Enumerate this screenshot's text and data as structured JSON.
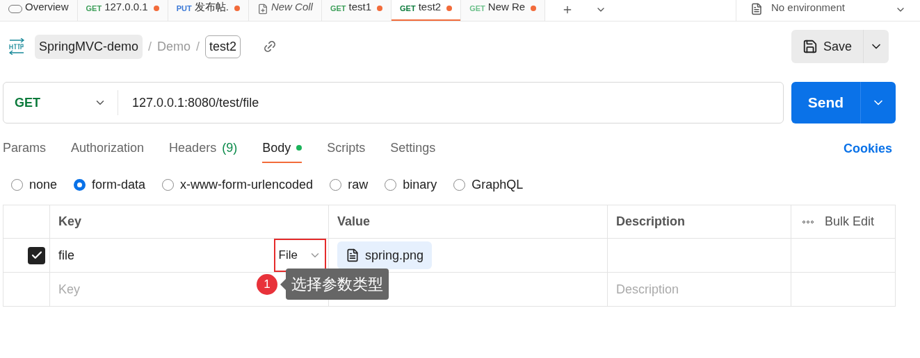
{
  "top_tabs": [
    {
      "kind": "overview",
      "label": "Overview",
      "selected": false
    },
    {
      "kind": "request",
      "method": "GET",
      "color": "#3e9f5a",
      "label": "127.0.0.1",
      "unsaved": true,
      "selected": false
    },
    {
      "kind": "request",
      "method": "PUT",
      "color": "#3a78d6",
      "label": "发布帖.",
      "unsaved": true,
      "selected": false
    },
    {
      "kind": "collection",
      "label": "New Coll",
      "selected": false
    },
    {
      "kind": "request",
      "method": "GET",
      "color": "#3e9f5a",
      "label": "test1",
      "unsaved": true,
      "selected": false
    },
    {
      "kind": "request",
      "method": "GET",
      "color": "#0b7a3b",
      "label": "test2",
      "unsaved": true,
      "selected": true
    },
    {
      "kind": "request",
      "method": "GET",
      "color": "#6cc08a",
      "label": "New Re",
      "unsaved": true,
      "selected": false
    }
  ],
  "environment": {
    "label": "No environment"
  },
  "breadcrumb": {
    "collection": "SpringMVC-demo",
    "separator_1": "/",
    "folder": "Demo",
    "separator_2": "/",
    "request": "test2"
  },
  "save_button": "Save",
  "request": {
    "method": "GET",
    "url": "127.0.0.1:8080/test/file"
  },
  "send_button": "Send",
  "sub_tabs": [
    {
      "label": "Params",
      "selected": false
    },
    {
      "label": "Authorization",
      "selected": false
    },
    {
      "label": "Headers",
      "count": "(9)",
      "selected": false
    },
    {
      "label": "Body",
      "has_content": true,
      "selected": true
    },
    {
      "label": "Scripts",
      "selected": false
    },
    {
      "label": "Settings",
      "selected": false
    }
  ],
  "cookies_link": "Cookies",
  "body_types": [
    {
      "label": "none",
      "selected": false
    },
    {
      "label": "form-data",
      "selected": true
    },
    {
      "label": "x-www-form-urlencoded",
      "selected": false
    },
    {
      "label": "raw",
      "selected": false
    },
    {
      "label": "binary",
      "selected": false
    },
    {
      "label": "GraphQL",
      "selected": false
    }
  ],
  "table": {
    "columns": [
      "Key",
      "Value",
      "Description"
    ],
    "bulk_edit": "Bulk Edit",
    "rows": [
      {
        "checked": true,
        "key": "file",
        "type": "File",
        "value": "spring.png"
      }
    ],
    "empty_row": {
      "key_placeholder": "Key",
      "description_placeholder": "Description"
    }
  },
  "annotation": {
    "number": "1",
    "text": "选择参数类型"
  }
}
